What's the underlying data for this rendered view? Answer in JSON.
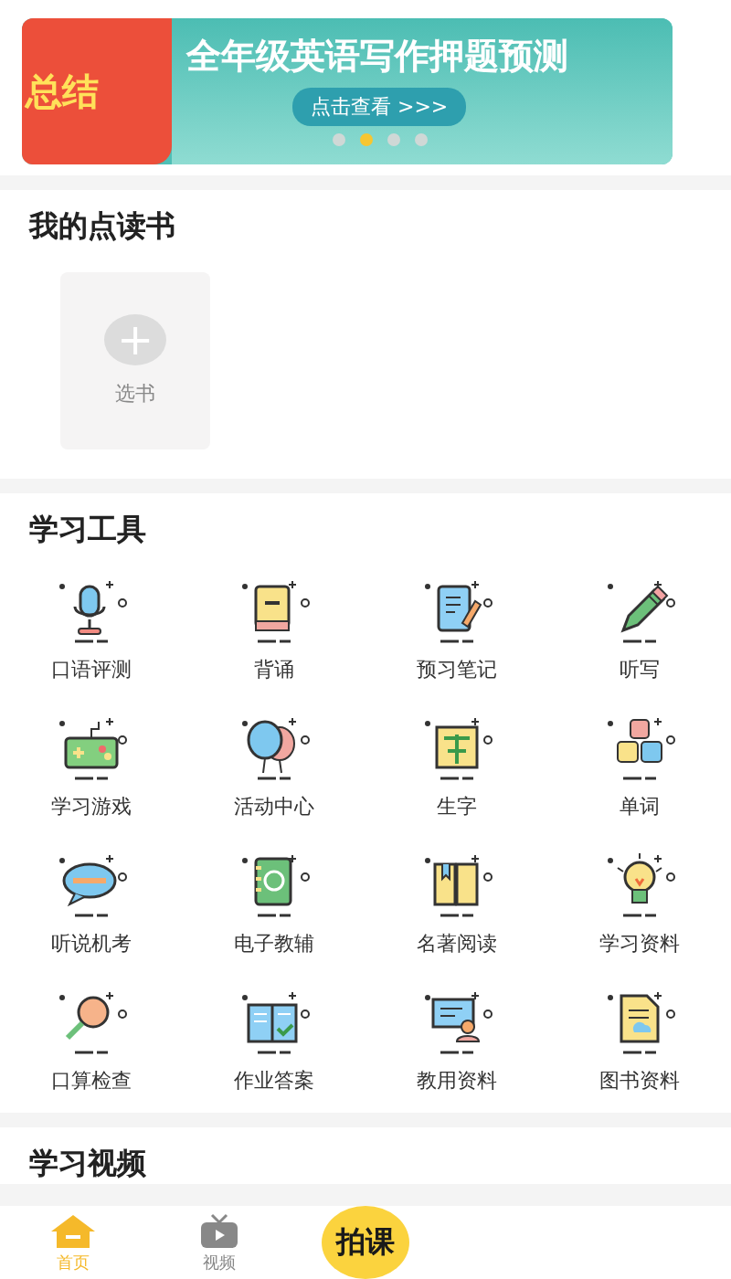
{
  "banner": {
    "side_text": "总结",
    "headline": "全年级英语写作押题预测",
    "cta": "点击查看 >>>",
    "dots": [
      {
        "selected": false
      },
      {
        "selected": true
      },
      {
        "selected": false
      },
      {
        "selected": false
      }
    ]
  },
  "my_books": {
    "title": "我的点读书",
    "add_label": "选书",
    "add_icon": "+"
  },
  "tools": {
    "title": "学习工具",
    "items": [
      {
        "label": "口语评测"
      },
      {
        "label": "背诵"
      },
      {
        "label": "预习笔记"
      },
      {
        "label": "听写"
      },
      {
        "label": "学习游戏"
      },
      {
        "label": "活动中心"
      },
      {
        "label": "生字"
      },
      {
        "label": "单词"
      },
      {
        "label": "听说机考"
      },
      {
        "label": "电子教辅"
      },
      {
        "label": "名著阅读"
      },
      {
        "label": "学习资料"
      },
      {
        "label": "口算检查"
      },
      {
        "label": "作业答案"
      },
      {
        "label": "教用资料"
      },
      {
        "label": "图书资料"
      }
    ]
  },
  "videos": {
    "title": "学习视频"
  },
  "bottom_nav": {
    "tabs": [
      {
        "label": "首页",
        "selected": true
      },
      {
        "label": "视频",
        "selected": false
      }
    ],
    "center_button": "拍课"
  }
}
